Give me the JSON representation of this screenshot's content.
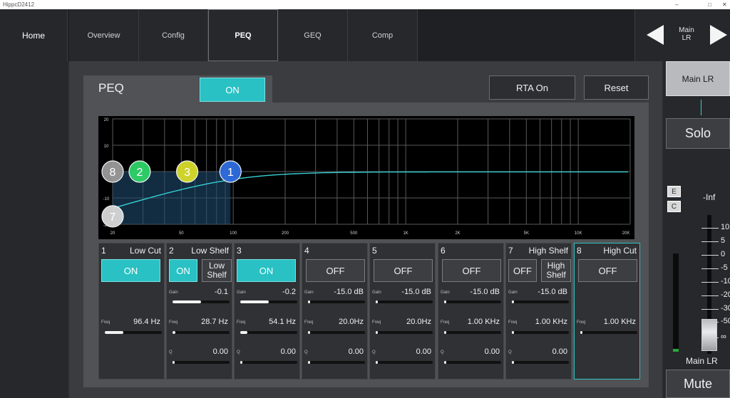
{
  "window": {
    "title": "HippcD2412",
    "controls": [
      "–",
      "□",
      "✕"
    ]
  },
  "nav": {
    "home": "Home",
    "tabs": [
      "Overview",
      "Config",
      "PEQ",
      "GEQ",
      "Comp"
    ],
    "active_tab": "PEQ",
    "channel": "Main\nLR"
  },
  "peq": {
    "title": "PEQ",
    "enable_label": "ON",
    "rta_label": "RTA On",
    "reset_label": "Reset"
  },
  "graph": {
    "y_ticks": [
      "20",
      "10",
      "0",
      "-10",
      "-20"
    ],
    "x_ticks": [
      "20",
      "50",
      "100",
      "200",
      "500",
      "1K",
      "2K",
      "5K",
      "10K",
      "20K"
    ],
    "nodes": [
      {
        "id": "8",
        "color": "#9a9a9a"
      },
      {
        "id": "2",
        "color": "#2fd36a"
      },
      {
        "id": "3",
        "color": "#d8dc2a"
      },
      {
        "id": "1",
        "color": "#2f6de0"
      },
      {
        "id": "7",
        "color": "#d8d8d8"
      }
    ],
    "curve_color": "#35d0d2"
  },
  "bands": [
    {
      "num": "1",
      "type": "Low Cut",
      "state": "ON",
      "freq_label": "Freq",
      "freq": "96.4 Hz",
      "freq_level": 0.32
    },
    {
      "num": "2",
      "type": "Low Shelf",
      "state": "ON",
      "type_btn": "Low\nShelf",
      "gain_label": "Gain",
      "gain": "-0.1",
      "gain_level": 0.5,
      "freq_label": "Freq",
      "freq": "28.7 Hz",
      "freq_level": 0.03,
      "q_label": "Q",
      "q": "0.00"
    },
    {
      "num": "3",
      "type": "",
      "state": "ON",
      "gain_label": "Gain",
      "gain": "-0.2",
      "gain_level": 0.5,
      "freq_label": "Freq",
      "freq": "54.1 Hz",
      "freq_level": 0.12,
      "q_label": "Q",
      "q": "0.00"
    },
    {
      "num": "4",
      "type": "",
      "state": "OFF",
      "gain_label": "Gain",
      "gain": "-15.0 dB",
      "gain_level": 0,
      "freq_label": "Freq",
      "freq": "20.0Hz",
      "freq_level": 0,
      "q_label": "Q",
      "q": "0.00"
    },
    {
      "num": "5",
      "type": "",
      "state": "OFF",
      "gain_label": "Gain",
      "gain": "-15.0 dB",
      "gain_level": 0,
      "freq_label": "Freq",
      "freq": "20.0Hz",
      "freq_level": 0,
      "q_label": "Q",
      "q": "0.00"
    },
    {
      "num": "6",
      "type": "",
      "state": "OFF",
      "gain_label": "Gain",
      "gain": "-15.0 dB",
      "gain_level": 0,
      "freq_label": "Freq",
      "freq": "1.00 KHz",
      "freq_level": 0,
      "q_label": "Q",
      "q": "0.00"
    },
    {
      "num": "7",
      "type": "High Shelf",
      "state": "OFF",
      "type_btn": "High\nShelf",
      "gain_label": "Gain",
      "gain": "-15.0 dB",
      "gain_level": 0,
      "freq_label": "Freq",
      "freq": "1.00 KHz",
      "freq_level": 0,
      "q_label": "Q",
      "q": "0.00"
    },
    {
      "num": "8",
      "type": "High Cut",
      "state": "OFF",
      "freq_label": "Freq",
      "freq": "1.00 KHz",
      "freq_level": 0
    }
  ],
  "right": {
    "channel_btn": "Main LR",
    "solo": "Solo",
    "e_label": "E",
    "c_label": "C",
    "level_readout": "-Inf",
    "scale": [
      "10",
      "5",
      "0",
      "-5",
      "-10",
      "-20",
      "-30",
      "-50",
      "∞"
    ],
    "channel_name": "Main LR",
    "mute": "Mute"
  }
}
